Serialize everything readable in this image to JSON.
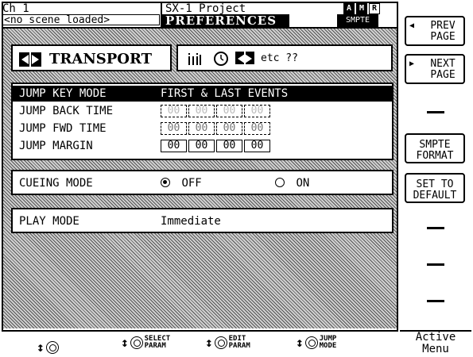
{
  "header": {
    "channel": "Ch 1",
    "scene": "<no scene loaded>",
    "project": "SX-1 Project",
    "page_title": "PREFERENCES",
    "badges": [
      "A",
      "M",
      "R"
    ],
    "smpte": "SMPTE"
  },
  "tabs": {
    "main_label": "TRANSPORT",
    "other_label": "etc ??"
  },
  "jump": {
    "rows": [
      {
        "label": "JUMP KEY MODE",
        "value": "FIRST & LAST EVENTS"
      },
      {
        "label": "JUMP BACK TIME",
        "value": ""
      },
      {
        "label": "JUMP FWD TIME",
        "value": ""
      },
      {
        "label": "JUMP MARGIN",
        "value": ""
      }
    ],
    "back_time": [
      "00",
      "00",
      "00",
      "00"
    ],
    "fwd_time": [
      "00",
      "00",
      "00",
      "00"
    ],
    "margin": [
      "00",
      "00",
      "00",
      "00"
    ]
  },
  "cueing": {
    "label": "CUEING MODE",
    "off_label": "OFF",
    "on_label": "ON",
    "selected": "OFF"
  },
  "play": {
    "label": "PLAY MODE",
    "value": "Immediate"
  },
  "bottom": {
    "knob2": "SELECT\nPARAM",
    "knob3": "EDIT\nPARAM",
    "knob4": "JUMP\nMODE"
  },
  "side": {
    "prev": "PREV PAGE",
    "next": "NEXT PAGE",
    "smpte_format": "SMPTE FORMAT",
    "set_default": "SET TO DEFAULT",
    "active_menu": "Active Menu"
  }
}
